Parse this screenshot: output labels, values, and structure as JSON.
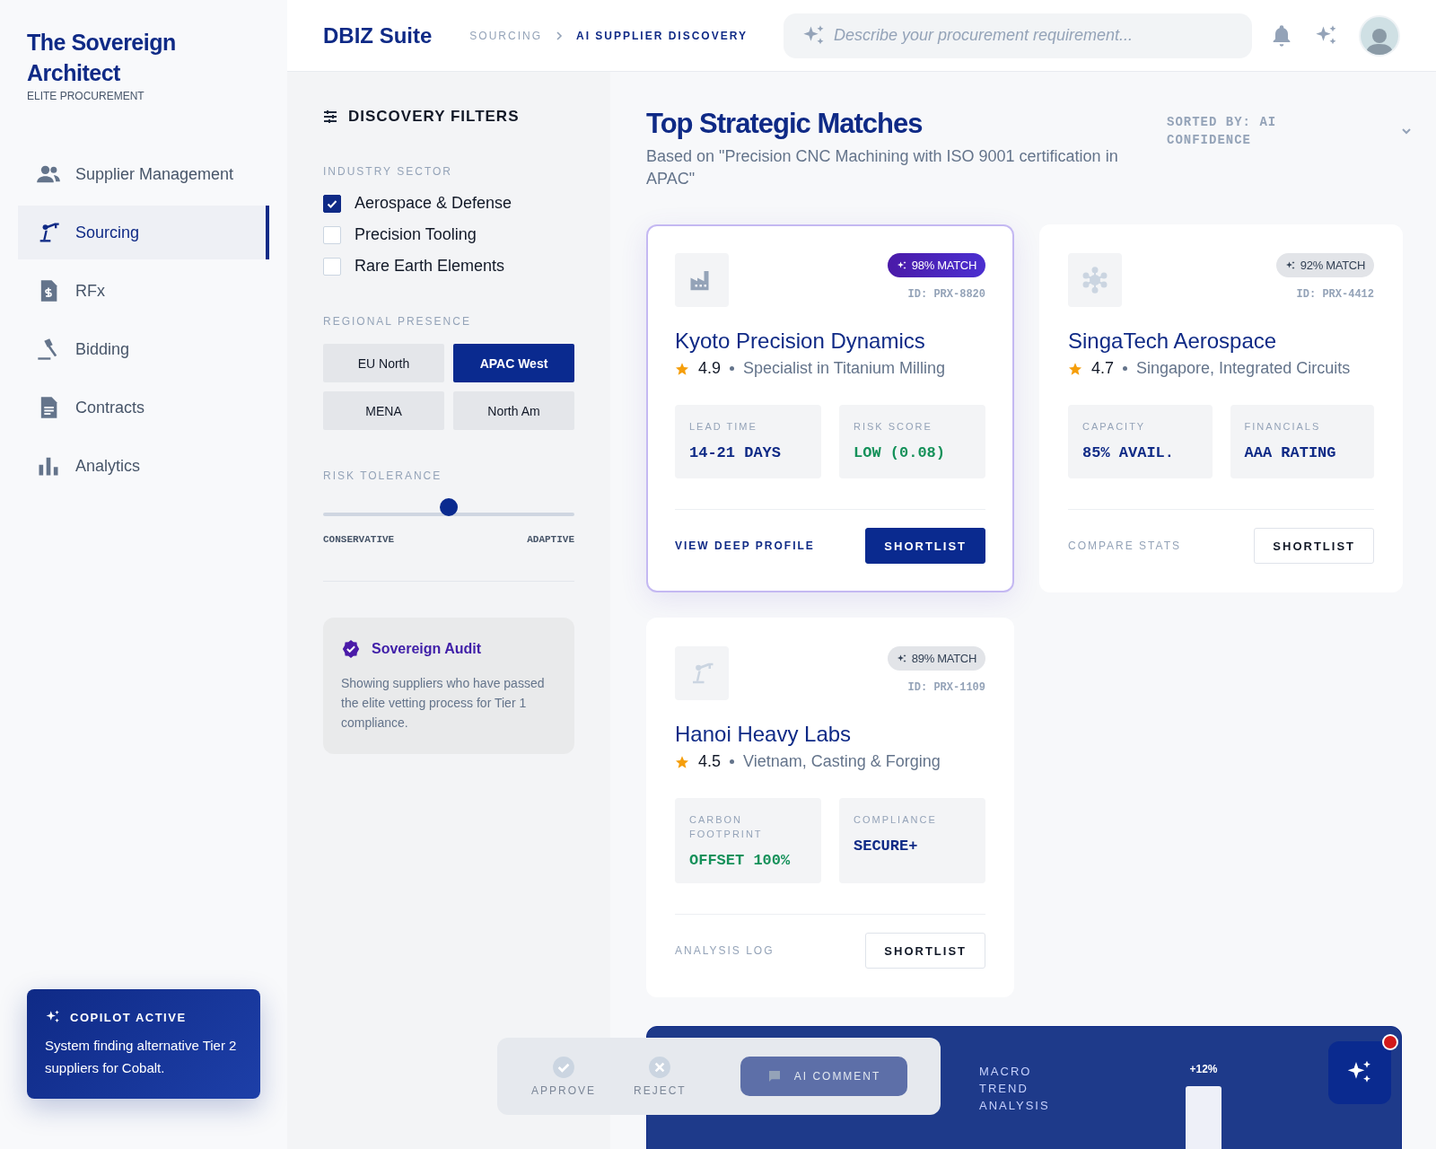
{
  "sidebar": {
    "brand_title": "The Sovereign Architect",
    "brand_subtitle": "ELITE PROCUREMENT",
    "nav_items": [
      {
        "label": "Supplier Management",
        "selected": false
      },
      {
        "label": "Sourcing",
        "selected": true
      },
      {
        "label": "RFx",
        "selected": false
      },
      {
        "label": "Bidding",
        "selected": false
      },
      {
        "label": "Contracts",
        "selected": false
      },
      {
        "label": "Analytics",
        "selected": false
      }
    ],
    "copilot": {
      "title": "COPILOT ACTIVE",
      "message": "System finding alternative Tier 2 suppliers for Cobalt."
    }
  },
  "header": {
    "title": "DBIZ Suite",
    "breadcrumbs": [
      {
        "label": "SOURCING",
        "selected": false
      },
      {
        "label": "AI SUPPLIER DISCOVERY",
        "selected": true
      }
    ],
    "search": {
      "placeholder": "Describe your procurement requirement..."
    }
  },
  "filters": {
    "title": "DISCOVERY FILTERS",
    "industry_sector": {
      "label": "INDUSTRY SECTOR",
      "options": [
        {
          "label": "Aerospace & Defense",
          "checked": true
        },
        {
          "label": "Precision Tooling",
          "checked": false
        },
        {
          "label": "Rare Earth Elements",
          "checked": false
        }
      ]
    },
    "regional_presence": {
      "label": "REGIONAL PRESENCE",
      "regions": [
        {
          "label": "EU North",
          "selected": false
        },
        {
          "label": "APAC West",
          "selected": true
        },
        {
          "label": "MENA",
          "selected": false
        },
        {
          "label": "North Am",
          "selected": false
        }
      ]
    },
    "risk_tolerance": {
      "label": "RISK TOLERANCE",
      "level": 0.5,
      "min_label": "CONSERVATIVE",
      "max_label": "ADAPTIVE"
    },
    "audit": {
      "title": "Sovereign Audit",
      "text": "Showing suppliers who have passed the elite vetting process for Tier 1 compliance."
    }
  },
  "results": {
    "title": "Top Strategic Matches",
    "subtitle": "Based on \"Precision CNC Machining with ISO 9001 certification in APAC\"",
    "sort_label": "SORTED BY: AI CONFIDENCE",
    "cards": [
      {
        "featured": true,
        "match": "98% MATCH",
        "id": "ID: PRX-8820",
        "name": "Kyoto Precision Dynamics",
        "rating": "4.9",
        "description": "Specialist in Titanium Milling",
        "metrics": [
          {
            "label": "LEAD TIME",
            "value": "14-21 DAYS",
            "kind": "neutral"
          },
          {
            "label": "RISK SCORE",
            "value": "LOW (0.08)",
            "kind": "positive"
          }
        ],
        "secondary_action": "VIEW DEEP PROFILE",
        "primary_action": "SHORTLIST"
      },
      {
        "featured": false,
        "match": "92% MATCH",
        "id": "ID: PRX-4412",
        "name": "SingaTech Aerospace",
        "rating": "4.7",
        "description": "Singapore, Integrated Circuits",
        "metrics": [
          {
            "label": "CAPACITY",
            "value": "85% AVAIL.",
            "kind": "neutral"
          },
          {
            "label": "FINANCIALS",
            "value": "AAA RATING",
            "kind": "neutral"
          }
        ],
        "secondary_action": "COMPARE STATS",
        "primary_action": "SHORTLIST"
      },
      {
        "featured": false,
        "match": "89% MATCH",
        "id": "ID: PRX-1109",
        "name": "Hanoi Heavy Labs",
        "rating": "4.5",
        "description": "Vietnam, Casting & Forging",
        "metrics": [
          {
            "label": "CARBON FOOTPRINT",
            "value": "OFFSET 100%",
            "kind": "positive"
          },
          {
            "label": "COMPLIANCE",
            "value": "SECURE+",
            "kind": "neutral"
          }
        ],
        "secondary_action": "ANALYSIS LOG",
        "primary_action": "SHORTLIST"
      }
    ]
  },
  "macro_panel": {
    "label": "MACRO TREND ANALYSIS",
    "value": "+12%"
  },
  "action_bar": {
    "actions": [
      {
        "label": "APPROVE"
      },
      {
        "label": "REJECT"
      },
      {
        "label": "AI COMMENT"
      }
    ]
  },
  "assistant_fab": {
    "has_notification": true
  }
}
